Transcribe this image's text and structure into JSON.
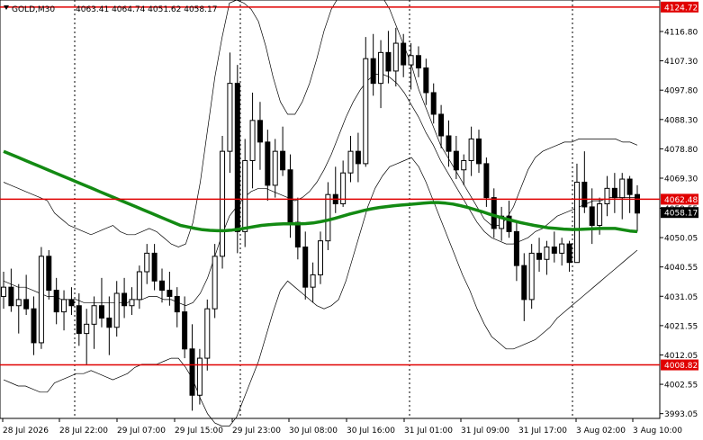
{
  "chart_data": {
    "type": "candlestick",
    "symbol_header": "GOLD,M30",
    "ohlc_header": "4063.41 4064.74 4051.62 4058.17",
    "y_ticks": [
      "4116.80",
      "4107.30",
      "4097.80",
      "4088.30",
      "4078.80",
      "4069.30",
      "4059.55",
      "4050.05",
      "4040.55",
      "4031.05",
      "4021.55",
      "4012.05",
      "4002.55",
      "3993.05"
    ],
    "x_ticks": [
      "28 Jul 2026",
      "28 Jul 22:00",
      "29 Jul 07:00",
      "29 Jul 15:00",
      "29 Jul 23:00",
      "30 Jul 08:00",
      "30 Jul 16:00",
      "31 Jul 01:00",
      "31 Jul 09:00",
      "31 Jul 17:00",
      "3 Aug 02:00",
      "3 Aug 10:00"
    ],
    "ylim": [
      3991.5,
      4127
    ],
    "horizontal_lines": [
      {
        "label": "4124.72",
        "value": 4124.72
      },
      {
        "label": "4062.48",
        "value": 4062.48
      },
      {
        "label": "4008.82",
        "value": 4008.82
      }
    ],
    "current_price_label": "4058.17",
    "current_price": 4058.17,
    "colors": {
      "levels": "#e00000",
      "ma": "#138a13",
      "bands": "#000000",
      "candles": "#000000"
    },
    "candles": [
      {
        "o": 4031,
        "h": 4039,
        "l": 4027,
        "c": 4034
      },
      {
        "o": 4034,
        "h": 4040,
        "l": 4026,
        "c": 4028
      },
      {
        "o": 4028,
        "h": 4035,
        "l": 4019,
        "c": 4030
      },
      {
        "o": 4030,
        "h": 4038,
        "l": 4025,
        "c": 4027
      },
      {
        "o": 4027,
        "h": 4031,
        "l": 4012,
        "c": 4016
      },
      {
        "o": 4016,
        "h": 4047,
        "l": 4014,
        "c": 4044
      },
      {
        "o": 4044,
        "h": 4046,
        "l": 4030,
        "c": 4033
      },
      {
        "o": 4033,
        "h": 4037,
        "l": 4022,
        "c": 4026
      },
      {
        "o": 4026,
        "h": 4033,
        "l": 4020,
        "c": 4030
      },
      {
        "o": 4030,
        "h": 4034,
        "l": 4025,
        "c": 4028
      },
      {
        "o": 4028,
        "h": 4032,
        "l": 4015,
        "c": 4019
      },
      {
        "o": 4019,
        "h": 4027,
        "l": 4009,
        "c": 4022
      },
      {
        "o": 4022,
        "h": 4031,
        "l": 4014,
        "c": 4028
      },
      {
        "o": 4028,
        "h": 4037,
        "l": 4021,
        "c": 4024
      },
      {
        "o": 4024,
        "h": 4031,
        "l": 4012,
        "c": 4021
      },
      {
        "o": 4021,
        "h": 4036,
        "l": 4018,
        "c": 4032
      },
      {
        "o": 4032,
        "h": 4037,
        "l": 4024,
        "c": 4028
      },
      {
        "o": 4028,
        "h": 4034,
        "l": 4025,
        "c": 4030
      },
      {
        "o": 4030,
        "h": 4041,
        "l": 4027,
        "c": 4039
      },
      {
        "o": 4039,
        "h": 4048,
        "l": 4035,
        "c": 4045
      },
      {
        "o": 4045,
        "h": 4048,
        "l": 4033,
        "c": 4036
      },
      {
        "o": 4036,
        "h": 4040,
        "l": 4029,
        "c": 4033
      },
      {
        "o": 4033,
        "h": 4039,
        "l": 4028,
        "c": 4031
      },
      {
        "o": 4031,
        "h": 4034,
        "l": 4021,
        "c": 4026
      },
      {
        "o": 4026,
        "h": 4031,
        "l": 4011,
        "c": 4014
      },
      {
        "o": 4014,
        "h": 4022,
        "l": 3994,
        "c": 3999
      },
      {
        "o": 3999,
        "h": 4014,
        "l": 3996,
        "c": 4011
      },
      {
        "o": 4011,
        "h": 4030,
        "l": 4007,
        "c": 4027
      },
      {
        "o": 4027,
        "h": 4048,
        "l": 4024,
        "c": 4044
      },
      {
        "o": 4044,
        "h": 4083,
        "l": 4040,
        "c": 4078
      },
      {
        "o": 4078,
        "h": 4110,
        "l": 4071,
        "c": 4100
      },
      {
        "o": 4100,
        "h": 4106,
        "l": 4045,
        "c": 4052
      },
      {
        "o": 4052,
        "h": 4082,
        "l": 4047,
        "c": 4075
      },
      {
        "o": 4075,
        "h": 4097,
        "l": 4066,
        "c": 4088
      },
      {
        "o": 4088,
        "h": 4094,
        "l": 4072,
        "c": 4081
      },
      {
        "o": 4081,
        "h": 4085,
        "l": 4062,
        "c": 4067
      },
      {
        "o": 4067,
        "h": 4082,
        "l": 4063,
        "c": 4078
      },
      {
        "o": 4078,
        "h": 4086,
        "l": 4070,
        "c": 4072
      },
      {
        "o": 4072,
        "h": 4077,
        "l": 4050,
        "c": 4055
      },
      {
        "o": 4055,
        "h": 4063,
        "l": 4043,
        "c": 4047
      },
      {
        "o": 4047,
        "h": 4052,
        "l": 4030,
        "c": 4034
      },
      {
        "o": 4034,
        "h": 4042,
        "l": 4029,
        "c": 4038
      },
      {
        "o": 4038,
        "h": 4052,
        "l": 4035,
        "c": 4049
      },
      {
        "o": 4049,
        "h": 4068,
        "l": 4046,
        "c": 4064
      },
      {
        "o": 4064,
        "h": 4073,
        "l": 4058,
        "c": 4061
      },
      {
        "o": 4061,
        "h": 4075,
        "l": 4060,
        "c": 4071
      },
      {
        "o": 4071,
        "h": 4083,
        "l": 4068,
        "c": 4078
      },
      {
        "o": 4078,
        "h": 4084,
        "l": 4068,
        "c": 4074
      },
      {
        "o": 4074,
        "h": 4115,
        "l": 4073,
        "c": 4108
      },
      {
        "o": 4108,
        "h": 4116,
        "l": 4096,
        "c": 4100
      },
      {
        "o": 4100,
        "h": 4114,
        "l": 4092,
        "c": 4110
      },
      {
        "o": 4110,
        "h": 4117,
        "l": 4100,
        "c": 4104
      },
      {
        "o": 4104,
        "h": 4118,
        "l": 4099,
        "c": 4113
      },
      {
        "o": 4113,
        "h": 4116,
        "l": 4102,
        "c": 4106
      },
      {
        "o": 4106,
        "h": 4113,
        "l": 4098,
        "c": 4109
      },
      {
        "o": 4109,
        "h": 4112,
        "l": 4102,
        "c": 4105
      },
      {
        "o": 4105,
        "h": 4108,
        "l": 4093,
        "c": 4097
      },
      {
        "o": 4097,
        "h": 4100,
        "l": 4087,
        "c": 4090
      },
      {
        "o": 4090,
        "h": 4093,
        "l": 4079,
        "c": 4083
      },
      {
        "o": 4083,
        "h": 4088,
        "l": 4073,
        "c": 4078
      },
      {
        "o": 4078,
        "h": 4083,
        "l": 4069,
        "c": 4072
      },
      {
        "o": 4072,
        "h": 4077,
        "l": 4067,
        "c": 4075
      },
      {
        "o": 4075,
        "h": 4086,
        "l": 4070,
        "c": 4082
      },
      {
        "o": 4082,
        "h": 4085,
        "l": 4071,
        "c": 4074
      },
      {
        "o": 4074,
        "h": 4076,
        "l": 4060,
        "c": 4063
      },
      {
        "o": 4063,
        "h": 4066,
        "l": 4050,
        "c": 4053
      },
      {
        "o": 4053,
        "h": 4060,
        "l": 4049,
        "c": 4057
      },
      {
        "o": 4057,
        "h": 4062,
        "l": 4050,
        "c": 4052
      },
      {
        "o": 4052,
        "h": 4055,
        "l": 4036,
        "c": 4041
      },
      {
        "o": 4041,
        "h": 4045,
        "l": 4023,
        "c": 4030
      },
      {
        "o": 4030,
        "h": 4048,
        "l": 4027,
        "c": 4045
      },
      {
        "o": 4045,
        "h": 4050,
        "l": 4039,
        "c": 4043
      },
      {
        "o": 4043,
        "h": 4049,
        "l": 4038,
        "c": 4047
      },
      {
        "o": 4047,
        "h": 4052,
        "l": 4042,
        "c": 4045
      },
      {
        "o": 4045,
        "h": 4050,
        "l": 4041,
        "c": 4048
      },
      {
        "o": 4048,
        "h": 4049,
        "l": 4039,
        "c": 4042
      },
      {
        "o": 4042,
        "h": 4074,
        "l": 4042,
        "c": 4068
      },
      {
        "o": 4068,
        "h": 4078,
        "l": 4058,
        "c": 4060
      },
      {
        "o": 4060,
        "h": 4066,
        "l": 4048,
        "c": 4054
      },
      {
        "o": 4054,
        "h": 4063,
        "l": 4051,
        "c": 4061
      },
      {
        "o": 4061,
        "h": 4070,
        "l": 4057,
        "c": 4066
      },
      {
        "o": 4066,
        "h": 4071,
        "l": 4058,
        "c": 4063
      },
      {
        "o": 4063,
        "h": 4071,
        "l": 4056,
        "c": 4069
      },
      {
        "o": 4069,
        "h": 4070,
        "l": 4058,
        "c": 4064
      },
      {
        "o": 4064,
        "h": 4067,
        "l": 4052,
        "c": 4058
      }
    ],
    "ma_series": [
      4078,
      4077,
      4076,
      4075,
      4074,
      4073,
      4072,
      4071,
      4070,
      4069,
      4068,
      4067,
      4066,
      4065,
      4064,
      4063,
      4062,
      4061,
      4060,
      4059,
      4058,
      4057,
      4056,
      4055,
      4054,
      4053.5,
      4053,
      4052.6,
      4052.4,
      4052.3,
      4052.3,
      4052.5,
      4052.8,
      4053.2,
      4053.6,
      4054,
      4054.2,
      4054.4,
      4054.5,
      4054.5,
      4054.5,
      4054.6,
      4054.8,
      4055.2,
      4055.7,
      4056.3,
      4057,
      4057.7,
      4058.3,
      4058.9,
      4059.4,
      4059.8,
      4060.1,
      4060.4,
      4060.6,
      4060.8,
      4061,
      4061.2,
      4061.4,
      4061.4,
      4061.2,
      4060.9,
      4060.4,
      4059.8,
      4059.1,
      4058.4,
      4057.6,
      4056.9,
      4056.2,
      4055.6,
      4055,
      4054.5,
      4054,
      4053.6,
      4053.2,
      4053,
      4052.8,
      4052.7,
      4052.7,
      4052.8,
      4052.9,
      4053,
      4053,
      4053,
      4052.6,
      4052.2,
      4052
    ],
    "band_upper": [
      4068,
      4067,
      4066,
      4065,
      4064,
      4063,
      4062,
      4058,
      4056,
      4054,
      4053,
      4052,
      4051,
      4052,
      4053,
      4054,
      4052,
      4051,
      4051,
      4052,
      4053,
      4052,
      4050,
      4048,
      4047,
      4048,
      4055,
      4068,
      4085,
      4102,
      4115,
      4126,
      4127,
      4126,
      4124,
      4120,
      4112,
      4102,
      4094,
      4090,
      4090,
      4094,
      4100,
      4108,
      4117,
      4124,
      4128,
      4130,
      4130,
      4131,
      4132,
      4131,
      4128,
      4124,
      4118,
      4112,
      4106,
      4098,
      4092,
      4086,
      4080,
      4076,
      4072,
      4068,
      4064,
      4060,
      4056,
      4054,
      4054,
      4056,
      4060,
      4066,
      4072,
      4076,
      4078,
      4079,
      4080,
      4081,
      4081,
      4082,
      4082,
      4082,
      4082,
      4082,
      4082,
      4081,
      4081,
      4080
    ],
    "band_mid": [
      4036,
      4035,
      4034,
      4034,
      4033,
      4032,
      4031,
      4031,
      4030,
      4030,
      4030,
      4029,
      4029,
      4029,
      4029,
      4029,
      4029,
      4029,
      4030,
      4030,
      4031,
      4031,
      4030,
      4030,
      4029,
      4028,
      4029,
      4032,
      4037,
      4044,
      4051,
      4057,
      4060,
      4063,
      4065,
      4066,
      4066,
      4065,
      4064,
      4063,
      4062,
      4063,
      4065,
      4068,
      4072,
      4077,
      4083,
      4089,
      4094,
      4098,
      4101,
      4103,
      4103,
      4102,
      4100,
      4097,
      4093,
      4089,
      4084,
      4080,
      4075,
      4071,
      4067,
      4063,
      4059,
      4055,
      4052,
      4050,
      4049,
      4048,
      4048,
      4049,
      4050,
      4052,
      4053,
      4055,
      4057,
      4058,
      4059,
      4060,
      4061,
      4062,
      4062,
      4063,
      4063,
      4063,
      4063,
      4063
    ],
    "band_lower": [
      4004,
      4003,
      4002,
      4002,
      4001,
      4000,
      4000,
      4003,
      4004,
      4005,
      4006,
      4006,
      4007,
      4006,
      4005,
      4004,
      4005,
      4006,
      4008,
      4009,
      4009,
      4009,
      4010,
      4011,
      4011,
      4008,
      4004,
      3998,
      3993,
      3990,
      3989,
      3989,
      3992,
      3998,
      4004,
      4010,
      4018,
      4026,
      4033,
      4036,
      4034,
      4032,
      4030,
      4028,
      4027,
      4028,
      4030,
      4036,
      4044,
      4052,
      4060,
      4066,
      4070,
      4073,
      4074,
      4075,
      4076,
      4073,
      4068,
      4062,
      4056,
      4050,
      4044,
      4038,
      4033,
      4027,
      4022,
      4018,
      4016,
      4014,
      4014,
      4015,
      4016,
      4017,
      4019,
      4021,
      4024,
      4026,
      4028,
      4030,
      4032,
      4034,
      4036,
      4038,
      4040,
      4042,
      4044,
      4046
    ]
  }
}
